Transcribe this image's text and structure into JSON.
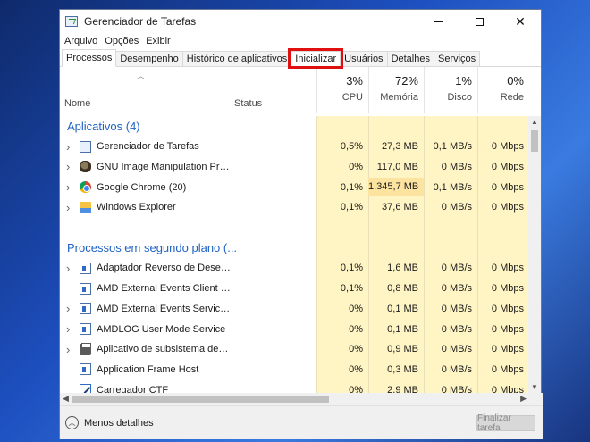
{
  "window": {
    "title": "Gerenciador de Tarefas"
  },
  "menu": [
    "Arquivo",
    "Opções",
    "Exibir"
  ],
  "tabs": [
    "Processos",
    "Desempenho",
    "Histórico de aplicativos",
    "Inicializar",
    "Usuários",
    "Detalhes",
    "Serviços"
  ],
  "active_tab": "Processos",
  "highlighted_tab": "Inicializar",
  "highlight_color": "#e01010",
  "columns": {
    "name": "Nome",
    "status": "Status",
    "cpu": {
      "percent": "3%",
      "label": "CPU"
    },
    "memory": {
      "percent": "72%",
      "label": "Memória"
    },
    "disk": {
      "percent": "1%",
      "label": "Disco"
    },
    "network": {
      "percent": "0%",
      "label": "Rede"
    }
  },
  "groups": {
    "apps": "Aplicativos (4)",
    "background": "Processos em segundo plano (..."
  },
  "rows": [
    {
      "type": "group",
      "key": "apps"
    },
    {
      "type": "proc",
      "icon": "task-manager-icon",
      "name": "Gerenciador de Tarefas",
      "cpu": "0,5%",
      "mem": "27,3 MB",
      "disk": "0,1 MB/s",
      "net": "0 Mbps",
      "expandable": true
    },
    {
      "type": "proc",
      "icon": "gimp-icon",
      "name": "GNU Image Manipulation Progr...",
      "cpu": "0%",
      "mem": "117,0 MB",
      "disk": "0 MB/s",
      "net": "0 Mbps",
      "expandable": true
    },
    {
      "type": "proc",
      "icon": "chrome-icon",
      "name": "Google Chrome (20)",
      "cpu": "0,1%",
      "mem": "1.345,7 MB",
      "disk": "0,1 MB/s",
      "net": "0 Mbps",
      "expandable": true,
      "mem_heat": "high"
    },
    {
      "type": "proc",
      "icon": "windows-explorer-icon",
      "name": "Windows Explorer",
      "cpu": "0,1%",
      "mem": "37,6 MB",
      "disk": "0 MB/s",
      "net": "0 Mbps",
      "expandable": true
    },
    {
      "type": "spacer"
    },
    {
      "type": "group",
      "key": "background"
    },
    {
      "type": "proc",
      "icon": "service-icon",
      "name": "Adaptador Reverso de Desempe...",
      "cpu": "0,1%",
      "mem": "1,6 MB",
      "disk": "0 MB/s",
      "net": "0 Mbps",
      "expandable": true
    },
    {
      "type": "proc",
      "icon": "service-icon",
      "name": "AMD External Events Client Mo...",
      "cpu": "0,1%",
      "mem": "0,8 MB",
      "disk": "0 MB/s",
      "net": "0 Mbps",
      "expandable": false
    },
    {
      "type": "proc",
      "icon": "service-icon",
      "name": "AMD External Events Service M...",
      "cpu": "0%",
      "mem": "0,1 MB",
      "disk": "0 MB/s",
      "net": "0 Mbps",
      "expandable": true
    },
    {
      "type": "proc",
      "icon": "service-icon",
      "name": "AMDLOG User Mode Service",
      "cpu": "0%",
      "mem": "0,1 MB",
      "disk": "0 MB/s",
      "net": "0 Mbps",
      "expandable": true
    },
    {
      "type": "proc",
      "icon": "printer-icon",
      "name": "Aplicativo de subsistema de spo...",
      "cpu": "0%",
      "mem": "0,9 MB",
      "disk": "0 MB/s",
      "net": "0 Mbps",
      "expandable": true
    },
    {
      "type": "proc",
      "icon": "service-icon",
      "name": "Application Frame Host",
      "cpu": "0%",
      "mem": "0,3 MB",
      "disk": "0 MB/s",
      "net": "0 Mbps",
      "expandable": false
    },
    {
      "type": "proc",
      "icon": "ctf-loader-icon",
      "name": "Carregador CTF",
      "cpu": "0%",
      "mem": "2,9 MB",
      "disk": "0 MB/s",
      "net": "0 Mbps",
      "expandable": false
    }
  ],
  "heat_colors": {
    "low": "#fff4c4",
    "high": "#fde3a0"
  },
  "footer": {
    "less_details": "Menos detalhes",
    "end_task": "Finalizar tarefa"
  }
}
